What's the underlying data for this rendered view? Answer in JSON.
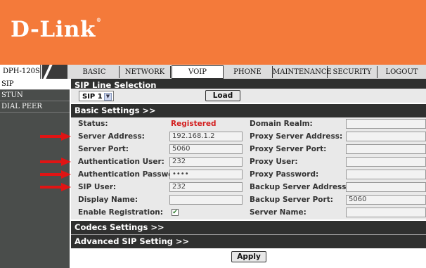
{
  "brand": {
    "name": "D-Link"
  },
  "model": "DPH-120S",
  "nav": {
    "tabs": [
      {
        "label": "BASIC"
      },
      {
        "label": "NETWORK"
      },
      {
        "label": "VOIP"
      },
      {
        "label": "PHONE"
      },
      {
        "label": "MAINTENANCE"
      },
      {
        "label": "SECURITY"
      },
      {
        "label": "LOGOUT"
      }
    ],
    "active_tab": "VOIP"
  },
  "sidebar": {
    "items": [
      {
        "label": "SIP"
      },
      {
        "label": "STUN"
      },
      {
        "label": "DIAL PEER"
      }
    ]
  },
  "sip_line": {
    "title": "SIP Line Selection",
    "selected": "SIP 1",
    "load_label": "Load"
  },
  "basic": {
    "title": "Basic Settings >>",
    "status_label": "Status:",
    "status_value": "Registered",
    "server_address_label": "Server Address:",
    "server_address_value": "192.168.1.2",
    "server_port_label": "Server Port:",
    "server_port_value": "5060",
    "auth_user_label": "Authentication User:",
    "auth_user_value": "232",
    "auth_password_label": "Authentication Password:",
    "auth_password_value": "••••",
    "sip_user_label": "SIP User:",
    "sip_user_value": "232",
    "display_name_label": "Display Name:",
    "display_name_value": "",
    "enable_reg_label": "Enable Registration:",
    "enable_reg_checked": true,
    "domain_realm_label": "Domain Realm:",
    "proxy_server_address_label": "Proxy Server Address:",
    "proxy_server_port_label": "Proxy Server Port:",
    "proxy_user_label": "Proxy User:",
    "proxy_password_label": "Proxy Password:",
    "backup_server_address_label": "Backup Server Address:",
    "backup_server_port_label": "Backup Server Port:",
    "backup_server_port_value": "5060",
    "server_name_label": "Server Name:"
  },
  "codecs": {
    "title": "Codecs Settings >>"
  },
  "advanced": {
    "title": "Advanced SIP Setting >>"
  },
  "apply_label": "Apply",
  "colors": {
    "header": "#f47a3a",
    "dark_bar": "#2f302f",
    "sidebar": "#4a4d4b",
    "status_red": "#d31f1f",
    "arrow_red": "#e01414"
  },
  "annotations": {
    "arrow_count": 5
  }
}
